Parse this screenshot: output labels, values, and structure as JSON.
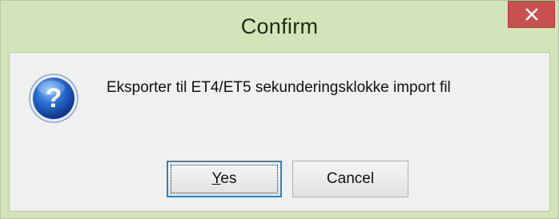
{
  "window": {
    "title": "Confirm",
    "close_icon": "close-x-icon"
  },
  "dialog": {
    "icon": "question-mark-icon",
    "message": "Eksporter til ET4/ET5 sekunderingsklokke import fil",
    "buttons": {
      "yes_label": "Yes",
      "cancel_label": "Cancel"
    }
  },
  "colors": {
    "titlebar": "#d2e5b8",
    "close_button": "#c75050",
    "client_background": "#f0f0f0",
    "default_button_border": "#3c7fb1"
  }
}
